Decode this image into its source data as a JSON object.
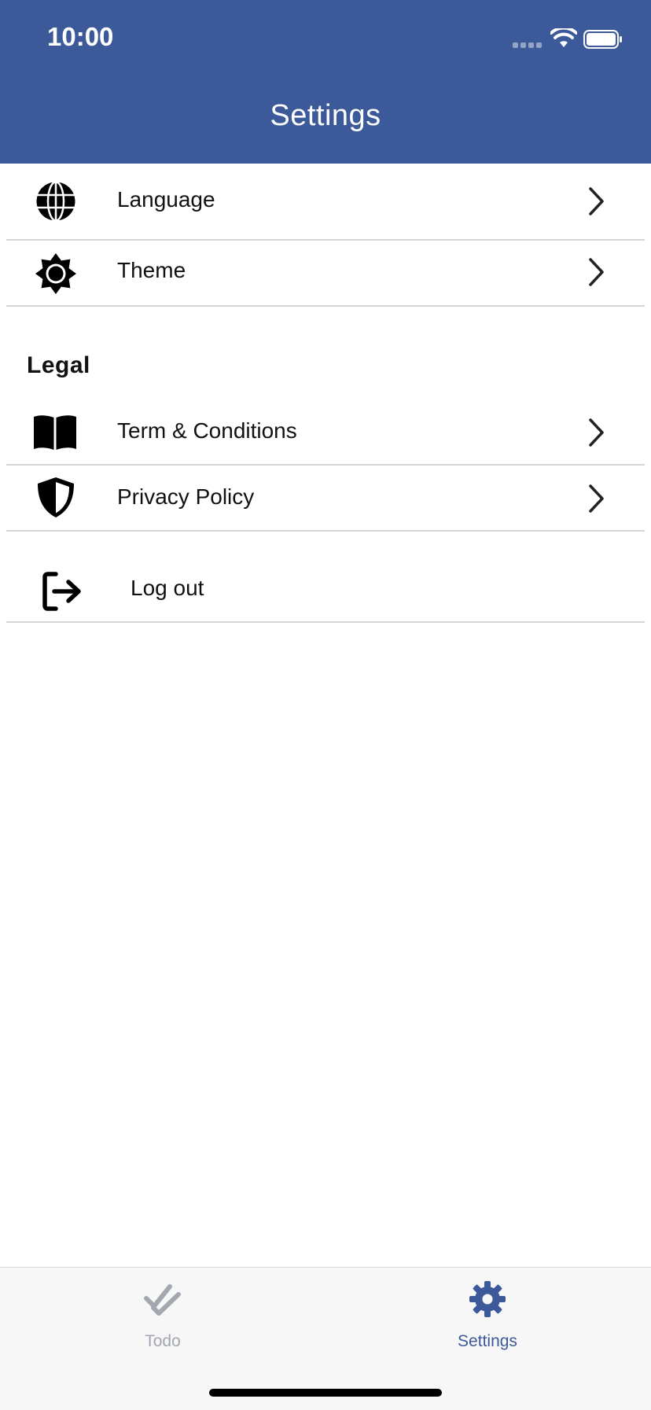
{
  "status_bar": {
    "time": "10:00",
    "signal_icon": "cellular-signal-icon",
    "wifi_icon": "wifi-icon",
    "battery_icon": "battery-icon"
  },
  "header": {
    "title": "Settings",
    "background_color": "#3c5a99"
  },
  "settings": {
    "items": [
      {
        "label": "Language",
        "icon": "globe-icon"
      },
      {
        "label": "Theme",
        "icon": "sun-icon"
      }
    ]
  },
  "legal": {
    "title": "Legal",
    "items": [
      {
        "label": "Term & Conditions",
        "icon": "book-icon"
      },
      {
        "label": "Privacy Policy",
        "icon": "shield-icon"
      }
    ]
  },
  "logout": {
    "label": "Log out",
    "icon": "logout-icon"
  },
  "tabbar": {
    "tabs": [
      {
        "label": "Todo",
        "icon": "double-check-icon",
        "active": false,
        "color": "#a3a7b0"
      },
      {
        "label": "Settings",
        "icon": "gear-icon",
        "active": true,
        "color": "#3c5a99"
      }
    ]
  }
}
